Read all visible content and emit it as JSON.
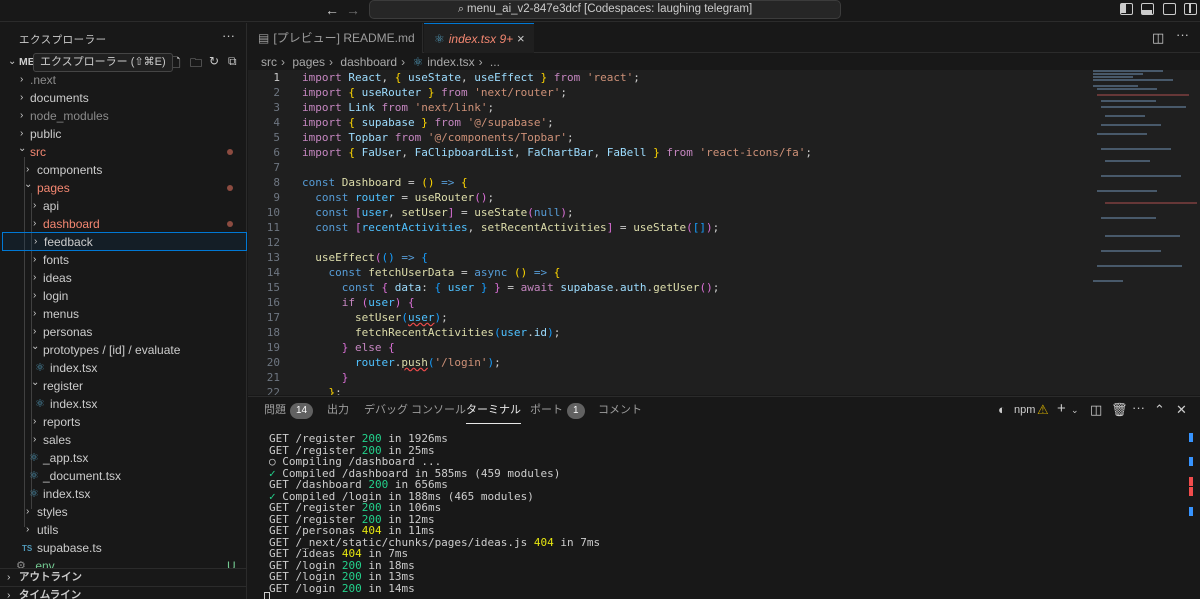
{
  "titlebar": {
    "back": "←",
    "forward": "→",
    "command_center": "menu_ai_v2-847e3dcf [Codespaces: laughing telegram]",
    "search_glyph": "⌕"
  },
  "sidebar": {
    "title": "エクスプローラー",
    "more": "···",
    "tooltip": "エクスプローラー (⇧⌘E)",
    "root": "ME",
    "items": [
      {
        "label": ".next",
        "chev": "›"
      },
      {
        "label": "documents",
        "chev": "›"
      },
      {
        "label": "node_modules",
        "chev": "›"
      },
      {
        "label": "public",
        "chev": "›"
      },
      {
        "label": "src",
        "chev": "⌄"
      },
      {
        "label": "components",
        "chev": "›"
      },
      {
        "label": "pages",
        "chev": "⌄"
      },
      {
        "label": "api",
        "chev": "›"
      },
      {
        "label": "dashboard",
        "chev": "›"
      },
      {
        "label": "feedback",
        "chev": "›"
      },
      {
        "label": "fonts",
        "chev": "›"
      },
      {
        "label": "ideas",
        "chev": "›"
      },
      {
        "label": "login",
        "chev": "›"
      },
      {
        "label": "menus",
        "chev": "›"
      },
      {
        "label": "personas",
        "chev": "›"
      },
      {
        "label": "prototypes / [id] / evaluate",
        "chev": "⌄"
      },
      {
        "label": "index.tsx",
        "chev": ""
      },
      {
        "label": "register",
        "chev": "⌄"
      },
      {
        "label": "index.tsx",
        "chev": ""
      },
      {
        "label": "reports",
        "chev": "›"
      },
      {
        "label": "sales",
        "chev": "›"
      },
      {
        "label": "_app.tsx",
        "chev": ""
      },
      {
        "label": "_document.tsx",
        "chev": ""
      },
      {
        "label": "index.tsx",
        "chev": ""
      },
      {
        "label": "styles",
        "chev": "›"
      },
      {
        "label": "utils",
        "chev": "›"
      },
      {
        "label": "supabase.ts",
        "chev": ""
      },
      {
        "label": ".env",
        "chev": ""
      }
    ],
    "ts_badge": "TS",
    "env_status": "U",
    "outline": "アウトライン",
    "timeline": "タイムライン"
  },
  "tabs": [
    {
      "label": "[プレビュー] README.md"
    },
    {
      "label": "index.tsx",
      "mod": "9+",
      "close": "×"
    }
  ],
  "breadcrumb": [
    "src",
    "pages",
    "dashboard",
    "index.tsx",
    "..."
  ],
  "code": [
    {
      "n": "1"
    },
    {
      "n": "2"
    },
    {
      "n": "3"
    },
    {
      "n": "4"
    },
    {
      "n": "5"
    },
    {
      "n": "6"
    },
    {
      "n": "7"
    },
    {
      "n": "8"
    },
    {
      "n": "9"
    },
    {
      "n": "10"
    },
    {
      "n": "11"
    },
    {
      "n": "12"
    },
    {
      "n": "13"
    },
    {
      "n": "14"
    },
    {
      "n": "15"
    },
    {
      "n": "16"
    },
    {
      "n": "17"
    },
    {
      "n": "18"
    },
    {
      "n": "19"
    },
    {
      "n": "20"
    },
    {
      "n": "21"
    },
    {
      "n": "22"
    }
  ],
  "panel": {
    "tabs": [
      {
        "label": "問題",
        "badge": "14"
      },
      {
        "label": "出力"
      },
      {
        "label": "デバッグ コンソール"
      },
      {
        "label": "ターミナル"
      },
      {
        "label": "ポート",
        "badge": "1"
      },
      {
        "label": "コメント"
      }
    ],
    "npm": "npm",
    "terminal": [
      {
        "pre": "GET /register ",
        "code": "200",
        "post": " in 1926ms",
        "c": "g"
      },
      {
        "pre": "GET /register ",
        "code": "200",
        "post": " in 25ms",
        "c": "g"
      },
      {
        "pre": "○ Compiling /dashboard ...",
        "code": "",
        "post": "",
        "c": ""
      },
      {
        "pre": "✓",
        "code": "",
        "post": " Compiled /dashboard in 585ms (459 modules)",
        "c": "g",
        "check": true
      },
      {
        "pre": "GET /dashboard ",
        "code": "200",
        "post": " in 656ms",
        "c": "g"
      },
      {
        "pre": "✓",
        "code": "",
        "post": " Compiled /login in 188ms (465 modules)",
        "c": "g",
        "check": true
      },
      {
        "pre": "GET /register ",
        "code": "200",
        "post": " in 106ms",
        "c": "g"
      },
      {
        "pre": "GET /register ",
        "code": "200",
        "post": " in 12ms",
        "c": "g"
      },
      {
        "pre": "GET /personas ",
        "code": "404",
        "post": " in 11ms",
        "c": "y"
      },
      {
        "pre": "GET /_next/static/chunks/pages/ideas.js ",
        "code": "404",
        "post": " in 7ms",
        "c": "y"
      },
      {
        "pre": "GET /ideas ",
        "code": "404",
        "post": " in 7ms",
        "c": "y"
      },
      {
        "pre": "GET /login ",
        "code": "200",
        "post": " in 18ms",
        "c": "g"
      },
      {
        "pre": "GET /login ",
        "code": "200",
        "post": " in 13ms",
        "c": "g"
      },
      {
        "pre": "GET /login ",
        "code": "200",
        "post": " in 14ms",
        "c": "g"
      }
    ]
  }
}
